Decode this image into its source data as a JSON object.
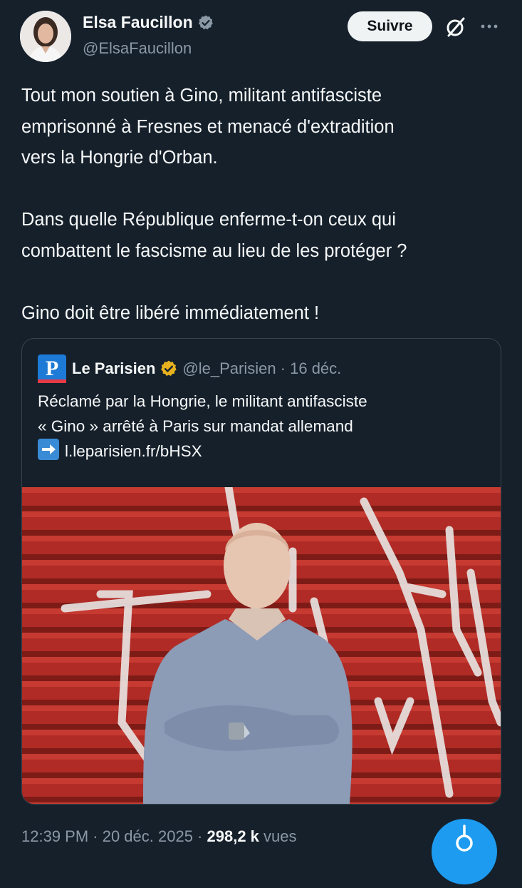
{
  "author": {
    "display_name": "Elsa Faucillon",
    "handle": "@ElsaFaucillon",
    "verified_icon": "verified-badge-icon"
  },
  "actions": {
    "follow_label": "Suivre",
    "grok_icon": "grok-icon",
    "more_icon": "more-icon"
  },
  "tweet": {
    "paragraphs": [
      "Tout mon soutien à Gino, militant antifasciste\nemprisonné à Fresnes et menacé d'extradition\nvers la Hongrie d'Orban.",
      "Dans quelle République enferme-t-on ceux qui\ncombattent le fascisme au lieu de les protéger ?",
      "Gino doit être libéré immédiatement !"
    ]
  },
  "quoted": {
    "logo_letter": "P",
    "name": "Le Parisien",
    "handle_date": "@le_Parisien · 16 déc.",
    "line1": "Réclamé par la Hongrie, le militant antifasciste",
    "line2": "« Gino » arrêté à Paris sur mandat allemand",
    "link": "l.leparisien.fr/bHSX"
  },
  "meta": {
    "time_date": "12:39 PM · 20 déc. 2025 · ",
    "views_count": "298,2 k",
    "views_label": " vues"
  },
  "colors": {
    "background": "#15202b",
    "text": "#f7f9f9",
    "muted": "#8b98a5",
    "accent": "#1d9bf0",
    "gold_badge": "#e8b21f"
  }
}
